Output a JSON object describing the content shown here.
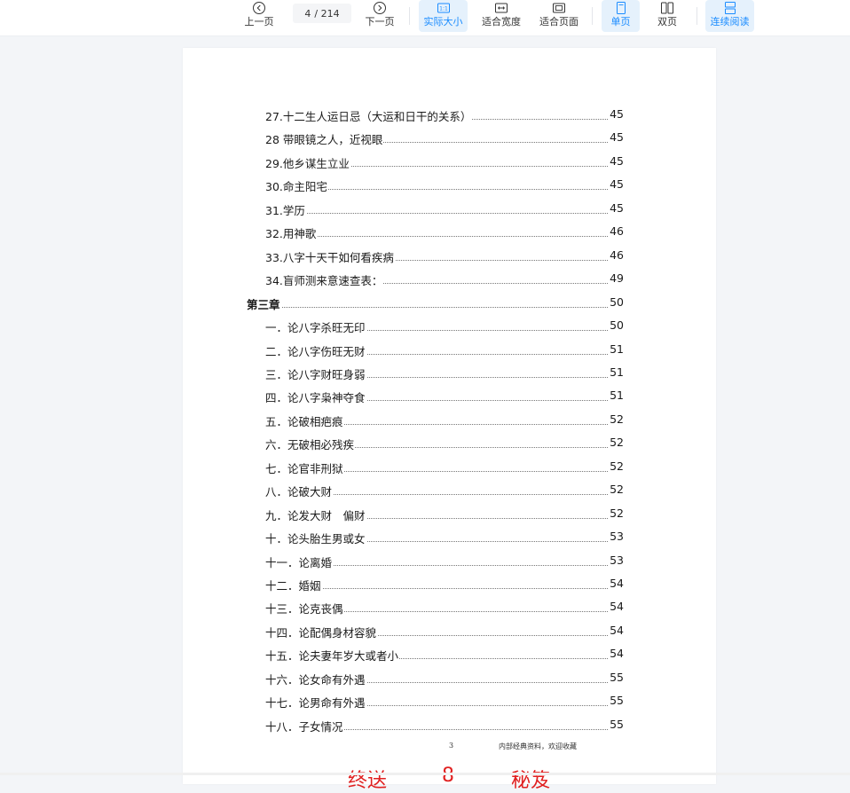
{
  "toolbar": {
    "prev_label": "上一页",
    "next_label": "下一页",
    "page_current": "4",
    "page_total": "/ 214",
    "actual_size_label": "实际大小",
    "actual_size_icon_text": "1:1",
    "fit_width_label": "适合宽度",
    "fit_page_label": "适合页面",
    "single_page_label": "单页",
    "double_page_label": "双页",
    "continuous_label": "连续阅读",
    "accent_color": "#1a8cff"
  },
  "toc": [
    {
      "title": "27.十二生人运日忌（大运和日干的关系）",
      "page": "45"
    },
    {
      "title": "28 带眼镜之人，近视眼",
      "page": "45"
    },
    {
      "title": "29.他乡谋生立业",
      "page": "45"
    },
    {
      "title": "30.命主阳宅",
      "page": "45"
    },
    {
      "title": "31.学历",
      "page": "45"
    },
    {
      "title": "32.用神歌",
      "page": "46"
    },
    {
      "title": "33.八字十天干如何看疾病",
      "page": "46"
    },
    {
      "title": "34.盲师测来意速查表：",
      "page": "49"
    },
    {
      "title": "第三章",
      "page": "50"
    },
    {
      "title": "一．论八字杀旺无印",
      "page": "50"
    },
    {
      "title": "二．论八字伤旺无财",
      "page": "51"
    },
    {
      "title": "三．论八字财旺身弱",
      "page": "51"
    },
    {
      "title": "四．论八字枭神夺食",
      "page": "51"
    },
    {
      "title": "五．论破相疤痕",
      "page": "52"
    },
    {
      "title": "六．无破相必残疾",
      "page": "52"
    },
    {
      "title": "七．论官非刑狱",
      "page": "52"
    },
    {
      "title": "八．论破大财",
      "page": "52"
    },
    {
      "title": "九．论发大财　偏财",
      "page": "52"
    },
    {
      "title": "十．论头胎生男或女",
      "page": "53"
    },
    {
      "title": "十一．论离婚",
      "page": "53"
    },
    {
      "title": "十二．婚姻",
      "page": "54"
    },
    {
      "title": "十三．论克丧偶",
      "page": "54"
    },
    {
      "title": "十四．论配偶身材容貌",
      "page": "54"
    },
    {
      "title": "十五．论夫妻年岁大或者小",
      "page": "54"
    },
    {
      "title": "十六．论女命有外遇",
      "page": "55"
    },
    {
      "title": "十七．论男命有外遇",
      "page": "55"
    },
    {
      "title": "十八．子女情况",
      "page": "55"
    }
  ],
  "footer": {
    "page_number": "3",
    "note": "内部经典资料，欢迎收藏"
  },
  "watermark": {
    "part1": "终送",
    "part2": "8",
    "part3": "秘笈"
  }
}
